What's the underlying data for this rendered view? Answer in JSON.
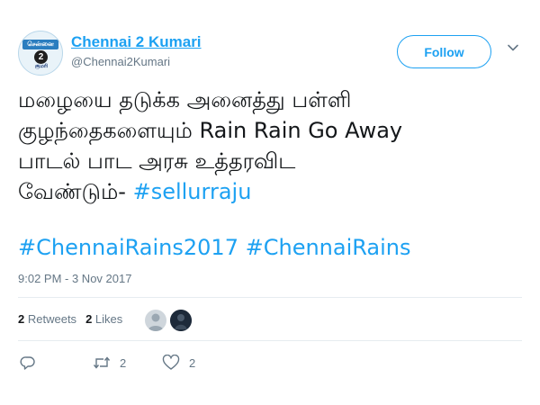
{
  "user": {
    "display_name": "Chennai 2 Kumari",
    "handle": "@Chennai2Kumari",
    "avatar_badge_text": "சென்னை",
    "avatar_number": "2",
    "avatar_sub_text": "குமரி"
  },
  "follow_button": {
    "label": "Follow"
  },
  "tweet": {
    "line1": "மழையை தடுக்க அனைத்து பள்ளி",
    "line2": "குழந்தைகளையும் Rain Rain Go Away",
    "line3": "பாடல் பாட அரசு உத்தரவிட",
    "line4_text": "வேண்டும்- ",
    "line4_hashtag": "#sellurraju",
    "hashtag1": "#ChennaiRains2017",
    "hashtag2": "#ChennaiRains"
  },
  "timestamp": "9:02 PM - 3 Nov 2017",
  "stats": {
    "retweets_count": "2",
    "retweets_label": "Retweets",
    "likes_count": "2",
    "likes_label": "Likes"
  },
  "actions": {
    "reply_icon": "reply-icon",
    "retweet_icon": "retweet-icon",
    "retweet_count": "2",
    "like_icon": "heart-icon",
    "like_count": "2"
  },
  "colors": {
    "accent": "#1da1f2",
    "text": "#14171a",
    "secondary": "#657786",
    "divider": "#e6ecf0"
  }
}
